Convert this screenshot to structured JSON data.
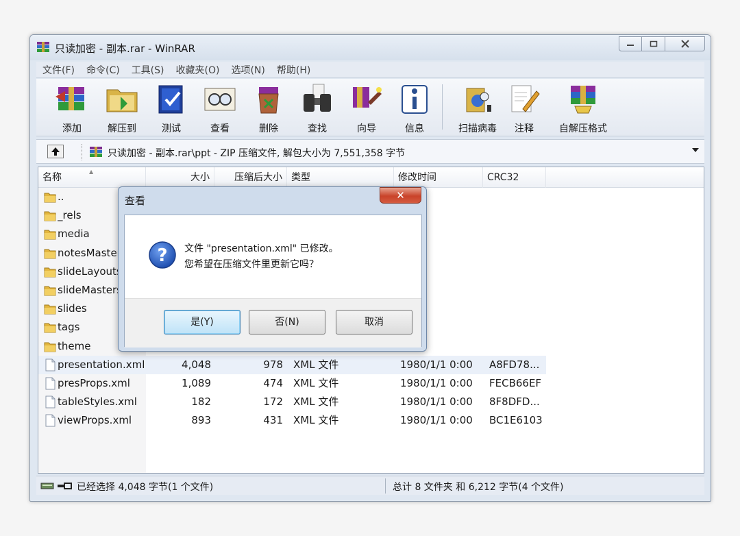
{
  "window": {
    "title": "只读加密 - 副本.rar - WinRAR"
  },
  "menu": [
    "文件(F)",
    "命令(C)",
    "工具(S)",
    "收藏夹(O)",
    "选项(N)",
    "帮助(H)"
  ],
  "toolbar": {
    "add": "添加",
    "extract": "解压到",
    "test": "测试",
    "view": "查看",
    "delete": "删除",
    "find": "查找",
    "wizard": "向导",
    "info": "信息",
    "scan": "扫描病毒",
    "comment": "注释",
    "sfx": "自解压格式"
  },
  "path": {
    "text": "只读加密 - 副本.rar\\ppt - ZIP 压缩文件, 解包大小为 7,551,358 字节"
  },
  "columns": {
    "name": "名称",
    "size": "大小",
    "packed": "压缩后大小",
    "type": "类型",
    "modified": "修改时间",
    "crc": "CRC32"
  },
  "files": [
    {
      "name": "..",
      "size": "",
      "packed": "",
      "type": "",
      "modified": "",
      "crc": "",
      "kind": "folder"
    },
    {
      "name": "_rels",
      "size": "",
      "packed": "",
      "type": "",
      "modified": "",
      "crc": "",
      "kind": "folder"
    },
    {
      "name": "media",
      "size": "",
      "packed": "",
      "type": "",
      "modified": "",
      "crc": "",
      "kind": "folder"
    },
    {
      "name": "notesMasters",
      "size": "",
      "packed": "",
      "type": "",
      "modified": "",
      "crc": "",
      "kind": "folder"
    },
    {
      "name": "slideLayouts",
      "size": "",
      "packed": "",
      "type": "",
      "modified": "",
      "crc": "",
      "kind": "folder"
    },
    {
      "name": "slideMasters",
      "size": "",
      "packed": "",
      "type": "",
      "modified": "",
      "crc": "",
      "kind": "folder"
    },
    {
      "name": "slides",
      "size": "",
      "packed": "",
      "type": "",
      "modified": "",
      "crc": "",
      "kind": "folder"
    },
    {
      "name": "tags",
      "size": "",
      "packed": "",
      "type": "",
      "modified": "",
      "crc": "",
      "kind": "folder"
    },
    {
      "name": "theme",
      "size": "",
      "packed": "",
      "type": "",
      "modified": "",
      "crc": "",
      "kind": "folder"
    },
    {
      "name": "presentation.xml",
      "size": "4,048",
      "packed": "978",
      "type": "XML 文件",
      "modified": "1980/1/1 0:00",
      "crc": "A8FD78...",
      "kind": "file",
      "selected": true
    },
    {
      "name": "presProps.xml",
      "size": "1,089",
      "packed": "474",
      "type": "XML 文件",
      "modified": "1980/1/1 0:00",
      "crc": "FECB66EF",
      "kind": "file"
    },
    {
      "name": "tableStyles.xml",
      "size": "182",
      "packed": "172",
      "type": "XML 文件",
      "modified": "1980/1/1 0:00",
      "crc": "8F8DFD...",
      "kind": "file"
    },
    {
      "name": "viewProps.xml",
      "size": "893",
      "packed": "431",
      "type": "XML 文件",
      "modified": "1980/1/1 0:00",
      "crc": "BC1E6103",
      "kind": "file"
    }
  ],
  "status": {
    "left": "已经选择 4,048 字节(1 个文件)",
    "right": "总计 8 文件夹 和 6,212 字节(4 个文件)"
  },
  "dialog": {
    "title": "查看",
    "close": "✕",
    "message_line1": "文件 \"presentation.xml\" 已修改。",
    "message_line2": "您希望在压缩文件里更新它吗？",
    "yes": "是(Y)",
    "no": "否(N)",
    "cancel": "取消"
  },
  "icons": {
    "up": "up-folder-icon",
    "question": "question-icon"
  }
}
